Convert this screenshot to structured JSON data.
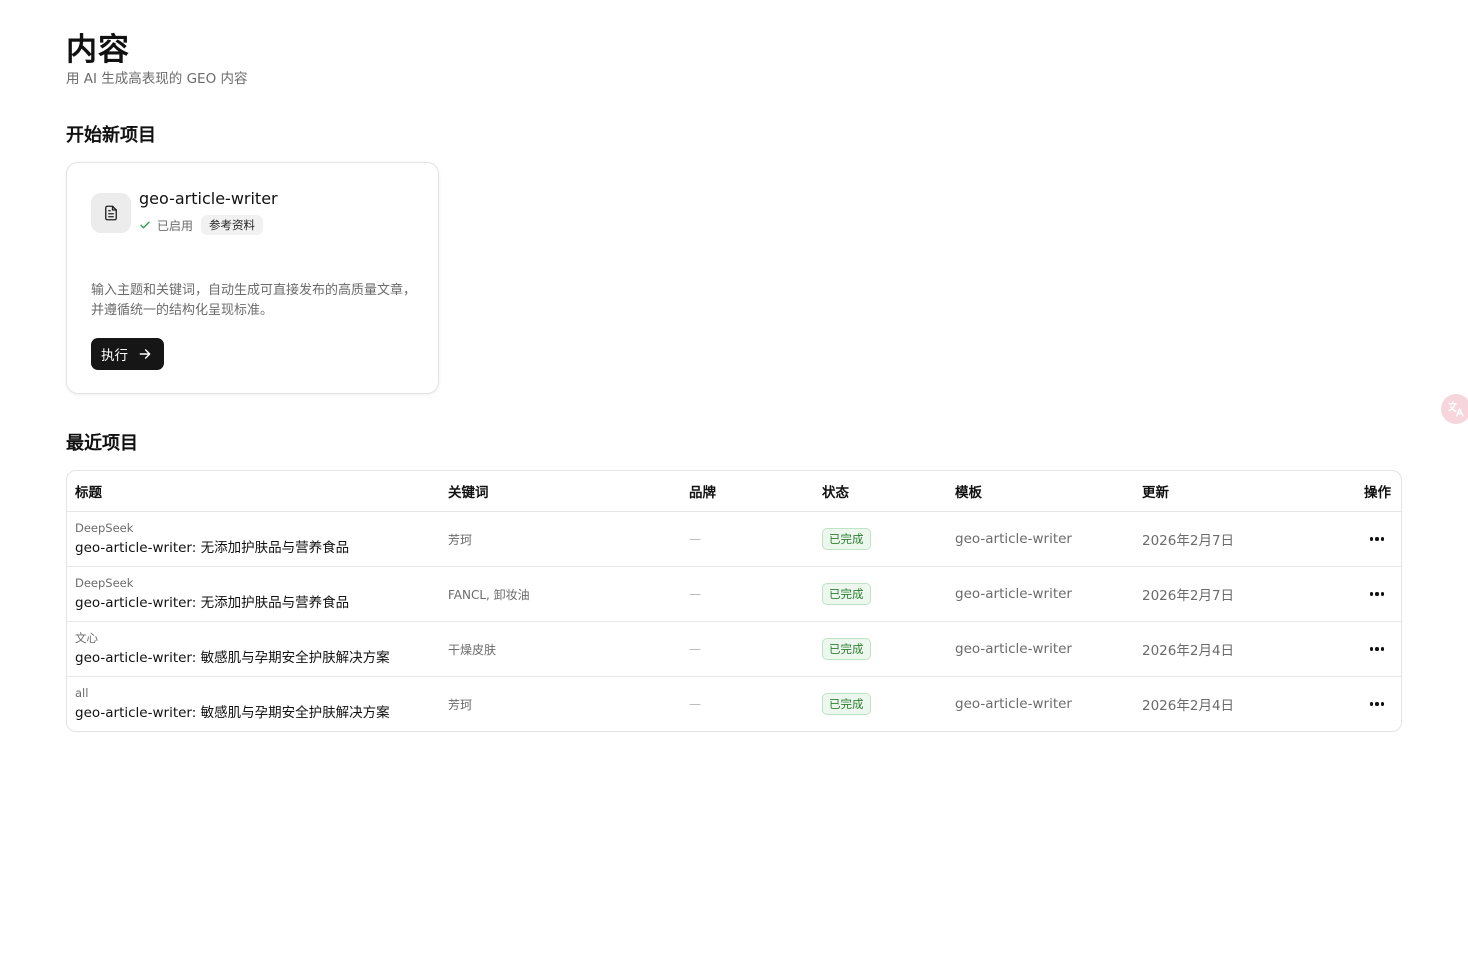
{
  "header": {
    "title": "内容",
    "subtitle": "用 AI 生成高表现的 GEO 内容"
  },
  "new_project": {
    "section_title": "开始新项目",
    "card": {
      "icon": "document-icon",
      "name": "geo-article-writer",
      "enabled_label": "已启用",
      "tag": "参考资料",
      "description": "输入主题和关键词，自动生成可直接发布的高质量文章，并遵循统一的结构化呈现标准。",
      "run_label": "执行"
    }
  },
  "recent": {
    "section_title": "最近项目",
    "columns": {
      "title": "标题",
      "keywords": "关键词",
      "brand": "品牌",
      "status": "状态",
      "template": "模板",
      "updated": "更新",
      "actions": "操作"
    },
    "rows": [
      {
        "engine": "DeepSeek",
        "title": "geo-article-writer: 无添加护肤品与营养食品",
        "keywords": "芳珂",
        "brand": "—",
        "status": "已完成",
        "template": "geo-article-writer",
        "updated": "2026年2月7日"
      },
      {
        "engine": "DeepSeek",
        "title": "geo-article-writer: 无添加护肤品与营养食品",
        "keywords": "FANCL, 卸妆油",
        "brand": "—",
        "status": "已完成",
        "template": "geo-article-writer",
        "updated": "2026年2月7日"
      },
      {
        "engine": "文心",
        "title": "geo-article-writer: 敏感肌与孕期安全护肤解决方案",
        "keywords": "干燥皮肤",
        "brand": "—",
        "status": "已完成",
        "template": "geo-article-writer",
        "updated": "2026年2月4日"
      },
      {
        "engine": "all",
        "title": "geo-article-writer: 敏感肌与孕期安全护肤解决方案",
        "keywords": "芳珂",
        "brand": "—",
        "status": "已完成",
        "template": "geo-article-writer",
        "updated": "2026年2月4日"
      }
    ]
  },
  "colors": {
    "primary_button": "#161616",
    "status_text": "#2e7d32",
    "status_bg": "#ecf8ee",
    "muted_text": "#6b6b6b"
  },
  "icons": {
    "translate": "translate-icon",
    "more": "more-horizontal-icon",
    "check": "check-icon",
    "arrow": "arrow-right-icon"
  }
}
